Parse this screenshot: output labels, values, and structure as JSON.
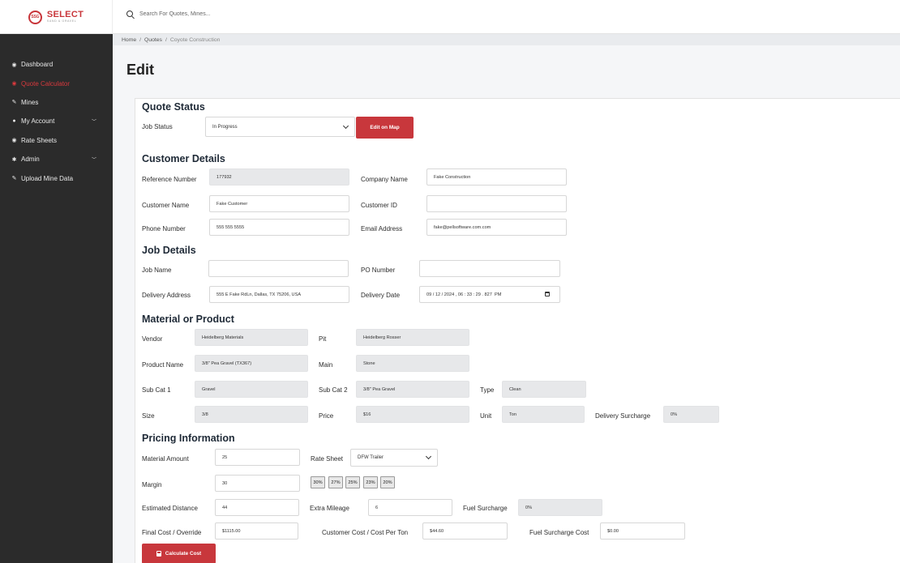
{
  "brand": {
    "name": "SELECT",
    "tagline": "SAND & GRAVEL",
    "mark": "SSG"
  },
  "search": {
    "placeholder": "Search For Quotes, Mines..."
  },
  "sidebar": {
    "items": [
      {
        "label": "Dashboard",
        "icon": "dashboard-icon",
        "glyph": "◉"
      },
      {
        "label": "Quote Calculator",
        "icon": "calculator-icon",
        "glyph": "◉"
      },
      {
        "label": "Mines",
        "icon": "edit-icon",
        "glyph": "✎"
      },
      {
        "label": "My Account",
        "icon": "user-icon",
        "glyph": "●"
      },
      {
        "label": "Rate Sheets",
        "icon": "rate-sheets-icon",
        "glyph": "◉"
      },
      {
        "label": "Admin",
        "icon": "gears-icon",
        "glyph": "✱"
      },
      {
        "label": "Upload Mine Data",
        "icon": "edit-icon",
        "glyph": "✎"
      }
    ],
    "active_color": "#d8393d"
  },
  "breadcrumb": {
    "home": "Home",
    "quotes": "Quotes",
    "current": "Coyote Construction"
  },
  "page": {
    "title": "Edit"
  },
  "quote_status": {
    "title": "Quote Status",
    "job_status_label": "Job Status",
    "job_status_value": "In Progress",
    "edit_on_map": "Edit on Map"
  },
  "customer": {
    "title": "Customer Details",
    "reference_number_label": "Reference Number",
    "reference_number": "177932",
    "company_name_label": "Company Name",
    "company_name": "Fake Construction",
    "customer_name_label": "Customer Name",
    "customer_name": "Fake Customer",
    "customer_id_label": "Customer ID",
    "customer_id": "",
    "phone_label": "Phone Number",
    "phone": "555 555 5555",
    "email_label": "Email Address",
    "email": "fake@pellsoftware.com.com"
  },
  "job": {
    "title": "Job Details",
    "job_name_label": "Job Name",
    "job_name": "",
    "po_label": "PO Number",
    "po": "",
    "delivery_address_label": "Delivery Address",
    "delivery_address": "555 E Fake RdLn, Dallas, TX 75206, USA",
    "delivery_date_label": "Delivery Date",
    "delivery_date": "09 / 12 / 2024 , 06 : 33 : 29 . 827  PM"
  },
  "material": {
    "title": "Material or Product",
    "vendor_label": "Vendor",
    "vendor": "Heidelberg Materials",
    "pit_label": "Pit",
    "pit": "Heidelberg Rosser",
    "product_name_label": "Product Name",
    "product_name": "3/8\" Pea Gravel (TX367)",
    "main_label": "Main",
    "main": "Stone",
    "sub_cat1_label": "Sub Cat 1",
    "sub_cat1": "Gravel",
    "sub_cat2_label": "Sub Cat 2",
    "sub_cat2": "3/8\" Pea Gravel",
    "type_label": "Type",
    "type": "Clean",
    "size_label": "Size",
    "size": "3/8",
    "price_label": "Price",
    "price": "$16",
    "unit_label": "Unit",
    "unit": "Ton",
    "delivery_surcharge_label": "Delivery Surcharge",
    "delivery_surcharge": "0%"
  },
  "pricing": {
    "title": "Pricing Information",
    "material_amount_label": "Material Amount",
    "material_amount": "25",
    "rate_sheet_label": "Rate Sheet",
    "rate_sheet": "DFW Trailer",
    "margin_label": "Margin",
    "margin": "30",
    "margin_presets": [
      "30%",
      "27%",
      "25%",
      "23%",
      "20%"
    ],
    "estimated_distance_label": "Estimated Distance",
    "estimated_distance": "44",
    "extra_mileage_label": "Extra Mileage",
    "extra_mileage": "6",
    "fuel_surcharge_label": "Fuel Surcharge",
    "fuel_surcharge": "0%",
    "final_cost_label": "Final Cost / Override",
    "final_cost": "$1115.00",
    "customer_cost_label": "Customer Cost / Cost Per Ton",
    "customer_cost": "$44.60",
    "fuel_surcharge_cost_label": "Fuel Surcharge Cost",
    "fuel_surcharge_cost": "$0.00",
    "calculate_button": "Calculate Cost"
  }
}
